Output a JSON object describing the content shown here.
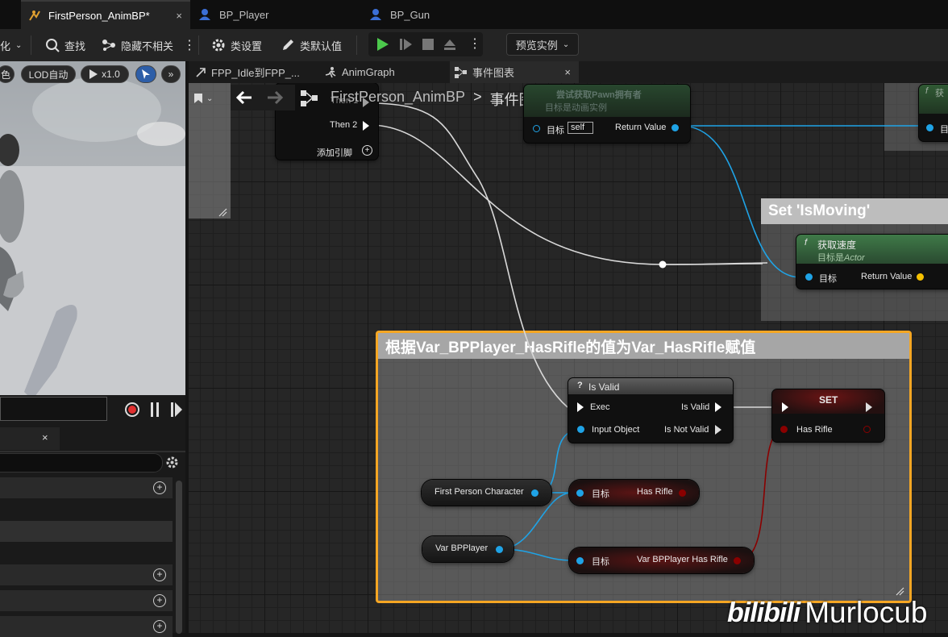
{
  "doc_tabs": [
    {
      "label": "FirstPerson_AnimBP*",
      "active": true,
      "close": "×"
    },
    {
      "label": "BP_Player",
      "active": false
    },
    {
      "label": "BP_Gun",
      "active": false
    }
  ],
  "toolbar": {
    "partial_left": "化",
    "find": "查找",
    "hide_unrelated": "隐藏不相关",
    "class_settings": "类设置",
    "class_defaults": "类默认值",
    "preview_instance": "预览实例"
  },
  "viewport": {
    "color_btn": "色",
    "lod": "LOD自动",
    "speed": "x1.0",
    "more": "»"
  },
  "details": {
    "close": "×"
  },
  "graph_tabs": [
    {
      "label": "FPP_Idle到FPP_...",
      "active": false
    },
    {
      "label": "AnimGraph",
      "active": false
    },
    {
      "label": "事件图表",
      "active": true,
      "close": "×"
    }
  ],
  "breadcrumb": {
    "root": "FirstPerson_AnimBP",
    "sep": ">",
    "current": "事件图表"
  },
  "sequence_node": {
    "then1": "Then 1",
    "then2": "Then 2",
    "add_pin": "添加引脚"
  },
  "try_get_pawn": {
    "title": "尝试获取Pawn拥有者",
    "subtitle": "目标是动画实例",
    "target": "目标",
    "self": "self",
    "return": "Return Value"
  },
  "right_fn": {
    "letter": "f",
    "char": "获",
    "target": "目"
  },
  "set_ismoving": {
    "comment": "Set 'IsMoving'",
    "fn_title": "获取速度",
    "fn_sub_prefix": "目标是",
    "fn_sub_class": "Actor",
    "target": "目标",
    "return": "Return Value"
  },
  "comment_box": {
    "title": "根据Var_BPPlayer_HasRifle的值为Var_HasRifle赋值"
  },
  "is_valid": {
    "title": "Is Valid",
    "q": "?",
    "exec": "Exec",
    "is_valid": "Is Valid",
    "input": "Input Object",
    "not_valid": "Is Not Valid"
  },
  "set_node": {
    "title": "SET",
    "pin": "Has Rifle"
  },
  "first_person_character": "First Person Character",
  "var_bpplayer": "Var BPPlayer",
  "get_has_rifle": {
    "target": "目标",
    "label": "Has Rifle"
  },
  "get_bpplayer_has_rifle": {
    "target": "目标",
    "label": "Var BPPlayer Has Rifle"
  },
  "watermark": {
    "logo": "bilibili",
    "name": "Murlocub"
  },
  "colors": {
    "exec_wire": "#d8d8d8",
    "object_pin": "#1fa3e6",
    "bool_pin": "#8a0000",
    "float_pin": "#f5c000",
    "comment_highlight": "#f5a623"
  }
}
